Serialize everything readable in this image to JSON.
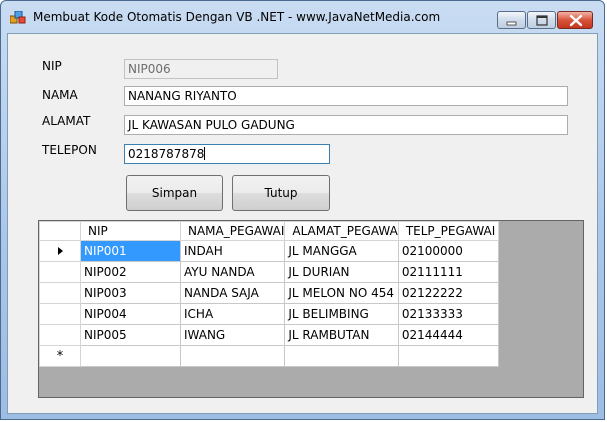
{
  "window": {
    "title": "Membuat Kode Otomatis Dengan VB .NET - www.JavaNetMedia.com",
    "icon": "app-window-icon"
  },
  "form": {
    "nip_label": "NIP",
    "nip_value": "NIP006",
    "nama_label": "NAMA",
    "nama_value": "NANANG RIYANTO",
    "alamat_label": "ALAMAT",
    "alamat_value": "JL KAWASAN PULO GADUNG",
    "telepon_label": "TELEPON",
    "telepon_value": "0218787878"
  },
  "buttons": {
    "simpan": "Simpan",
    "tutup": "Tutup"
  },
  "grid": {
    "columns": [
      "NIP",
      "NAMA_PEGAWAI",
      "ALAMAT_PEGAWA",
      "TELP_PEGAWAI"
    ],
    "rows": [
      [
        "NIP001",
        "INDAH",
        "JL MANGGA",
        "02100000"
      ],
      [
        "NIP002",
        "AYU NANDA",
        "JL DURIAN",
        "02111111"
      ],
      [
        "NIP003",
        "NANDA SAJA",
        "JL MELON NO 454",
        "02122222"
      ],
      [
        "NIP004",
        "ICHA",
        "JL BELIMBING",
        "02133333"
      ],
      [
        "NIP005",
        "IWANG",
        "JL RAMBUTAN",
        "02144444"
      ]
    ],
    "new_row_marker": "*"
  },
  "colors": {
    "selection": "#3399ff",
    "grid_background": "#ababab"
  }
}
